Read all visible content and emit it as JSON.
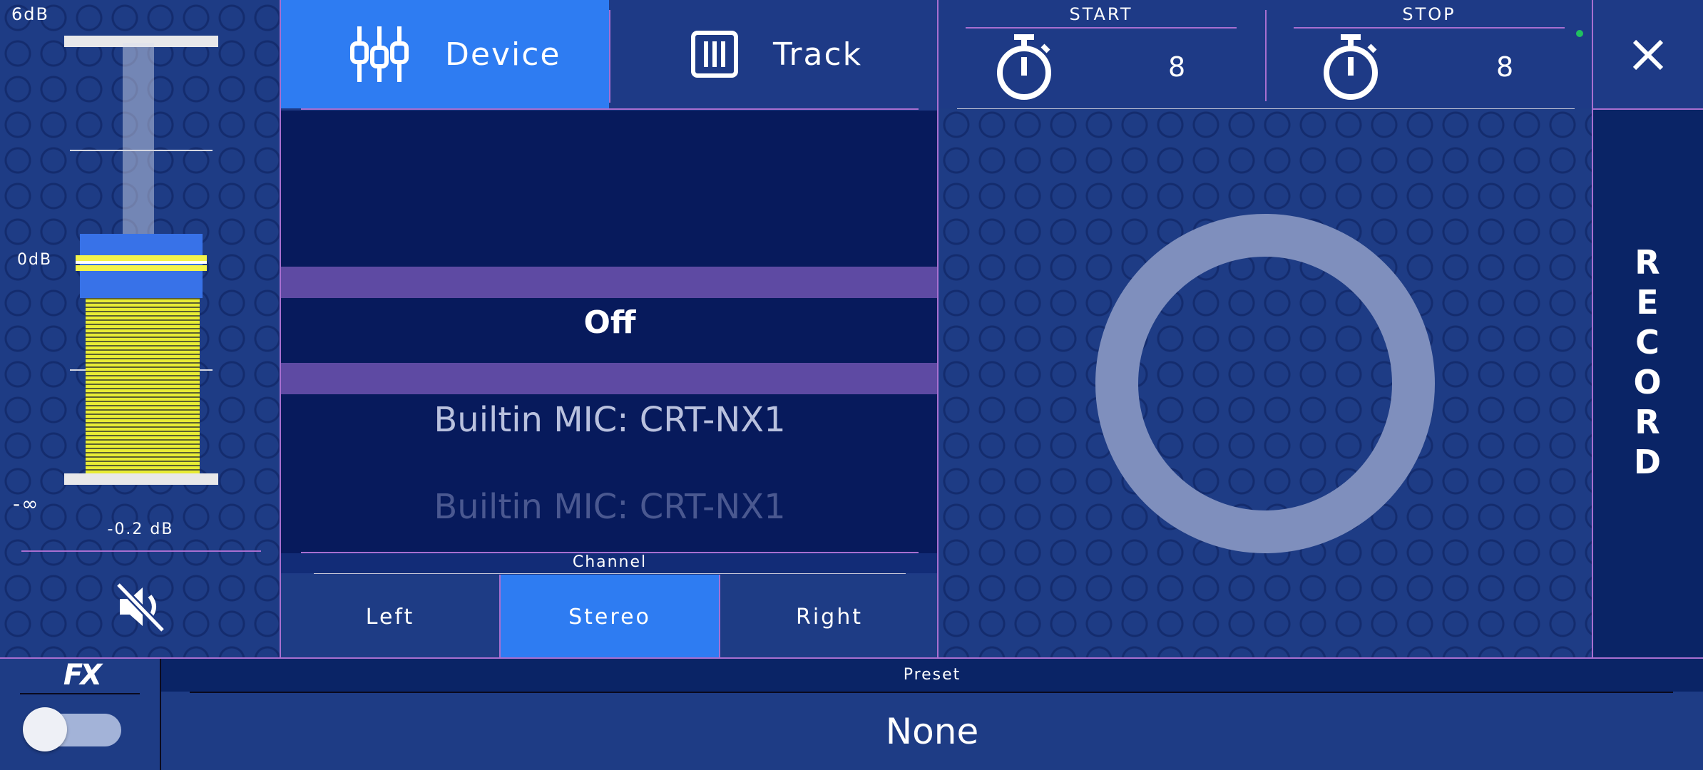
{
  "meter": {
    "top_label": "6dB",
    "zero_label": "0dB",
    "min_label": "-∞",
    "value_label": "-0.2 dB"
  },
  "tabs": [
    {
      "label": "Device",
      "icon": "sliders-icon",
      "active": true
    },
    {
      "label": "Track",
      "icon": "track-grid-icon",
      "active": false
    }
  ],
  "device_list": {
    "selected": "Off",
    "options": [
      "Builtin MIC: CRT-NX1",
      "Builtin MIC: CRT-NX1"
    ]
  },
  "channel": {
    "header": "Channel",
    "options": [
      {
        "label": "Left",
        "active": false
      },
      {
        "label": "Stereo",
        "active": true
      },
      {
        "label": "Right",
        "active": false
      }
    ]
  },
  "timers": {
    "start": {
      "label": "START",
      "value": "8"
    },
    "stop": {
      "label": "STOP",
      "value": "8"
    }
  },
  "record": {
    "vertical_label": "RECORD"
  },
  "fx": {
    "logo": "FX",
    "enabled": false
  },
  "preset": {
    "header": "Preset",
    "value": "None"
  },
  "colors": {
    "accent": "#2e7cf2",
    "selection": "#5e4aa3",
    "meter_level": "#e8ec35",
    "status_dot": "#20c060"
  }
}
